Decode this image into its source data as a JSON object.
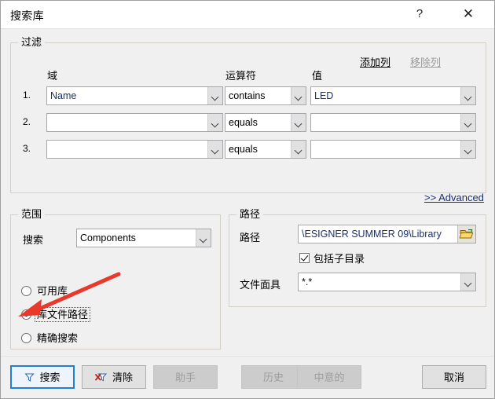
{
  "window": {
    "title": "搜索库",
    "help_glyph": "?",
    "close_glyph": "✕"
  },
  "filter": {
    "group_title": "过滤",
    "add_column_label": "添加列",
    "remove_column_label": "移除列",
    "advanced_label": ">> Advanced",
    "headers": {
      "field": "域",
      "operator": "运算符",
      "value": "值"
    },
    "rows": [
      {
        "num": "1.",
        "field": "Name",
        "operator": "contains",
        "value": "LED"
      },
      {
        "num": "2.",
        "field": "",
        "operator": "equals",
        "value": ""
      },
      {
        "num": "3.",
        "field": "",
        "operator": "equals",
        "value": ""
      }
    ]
  },
  "scope": {
    "group_title": "范围",
    "search_label": "搜索",
    "search_value": "Components",
    "options": [
      {
        "label": "可用库",
        "checked": false
      },
      {
        "label": "库文件路径",
        "checked": true
      },
      {
        "label": "精确搜索",
        "checked": false
      }
    ]
  },
  "path": {
    "group_title": "路径",
    "path_label": "路径",
    "path_value": "ESIGNER SUMMER 09\\Library\\",
    "browse_icon": "folder-open-icon",
    "include_subdirs_label": "包括子目录",
    "include_subdirs_checked": true,
    "file_mask_label": "文件面具",
    "file_mask_value": "*.*"
  },
  "footer": {
    "search_label": "搜索",
    "clear_label": "清除",
    "helper_label": "助手",
    "history_label": "历史",
    "favorites_label": "中意的",
    "cancel_label": "取消"
  },
  "annotation": {
    "arrow_color": "#e8392c"
  }
}
